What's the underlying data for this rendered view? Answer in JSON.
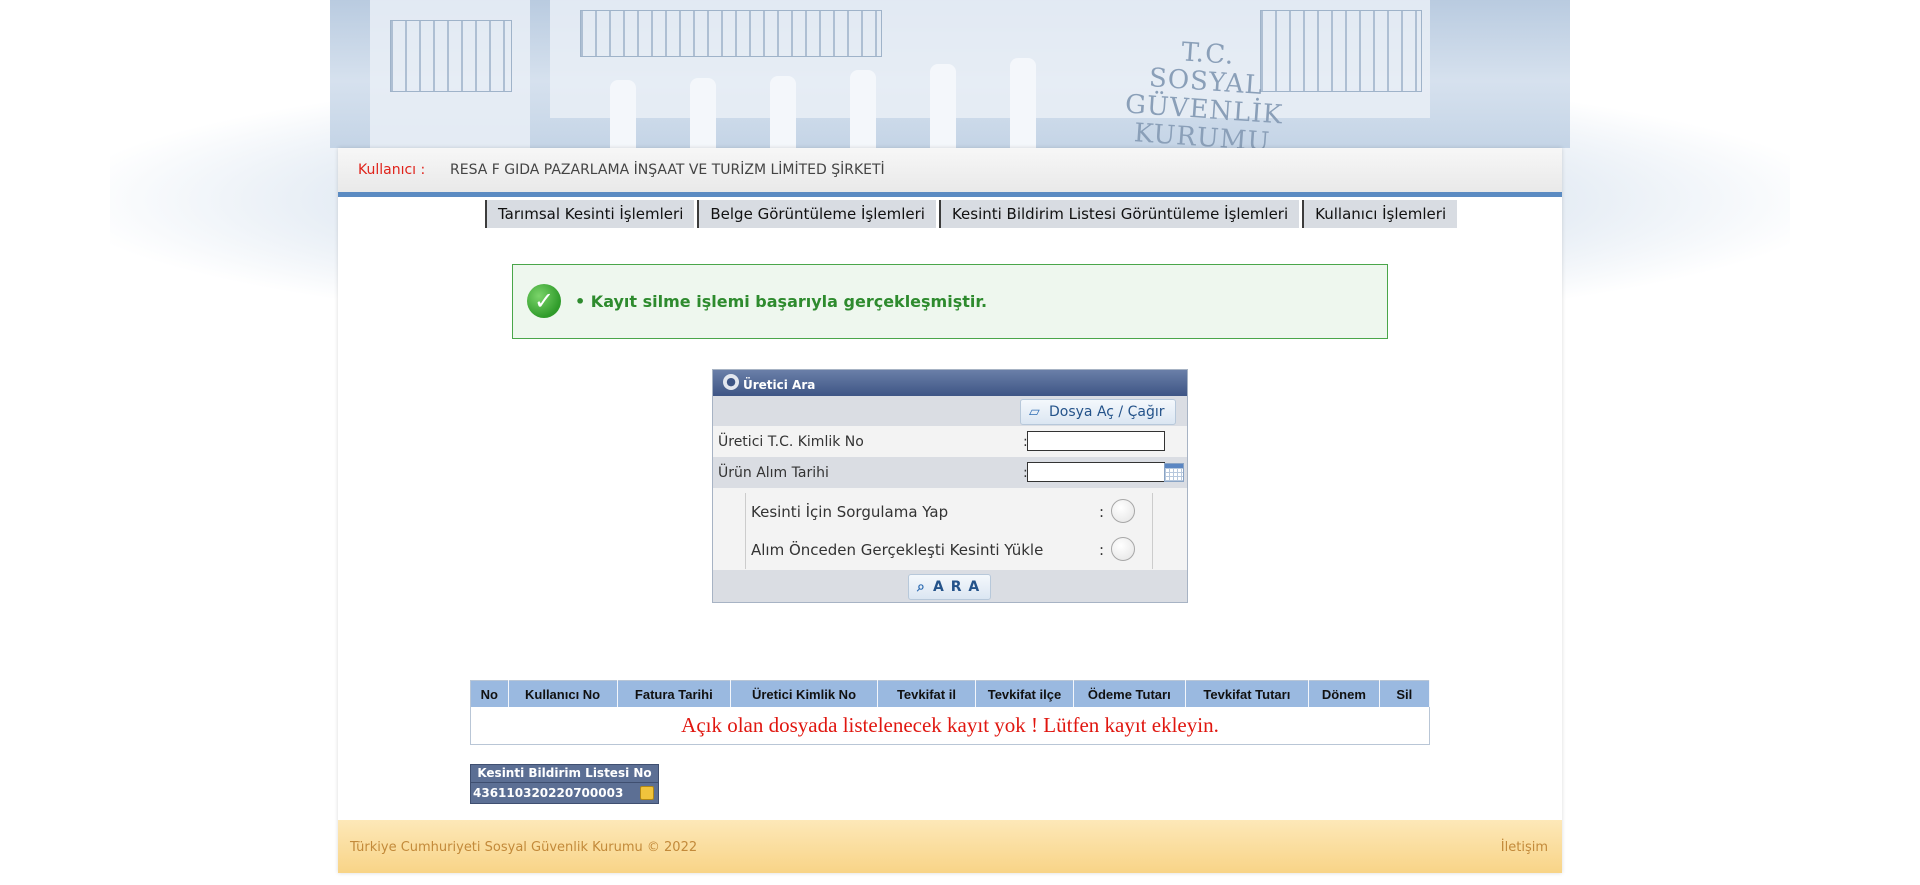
{
  "header": {
    "sign_lines": [
      "T.C.",
      "SOSYAL",
      "GÜVENLİK",
      "KURUMU"
    ]
  },
  "userbar": {
    "label": "Kullanıcı :",
    "value": "RESA F GIDA PAZARLAMA İNŞAAT VE TURİZM LİMİTED ŞİRKETİ"
  },
  "menu": {
    "items": [
      "Tarımsal Kesinti İşlemleri",
      "Belge Görüntüleme İşlemleri",
      "Kesinti Bildirim Listesi Görüntüleme İşlemleri",
      "Kullanıcı İşlemleri"
    ]
  },
  "success": {
    "message": "•  Kayıt silme işlemi başarıyla gerçekleşmiştir."
  },
  "search": {
    "title": "Üretici Ara",
    "file_button": "Dosya Aç / Çağır",
    "tc_label": "Üretici T.C. Kimlik No",
    "tc_value": "",
    "date_label": "Ürün Alım Tarihi",
    "date_value": "",
    "option1": "Kesinti İçin Sorgulama Yap",
    "option2": "Alım Önceden Gerçekleşti Kesinti Yükle",
    "colon": ":",
    "search_button": "A R A"
  },
  "table": {
    "columns": [
      "No",
      "Kullanıcı No",
      "Fatura Tarihi",
      "Üretici Kimlik No",
      "Tevkifat il",
      "Tevkifat ilçe",
      "Ödeme Tutarı",
      "Tevkifat Tutarı",
      "Dönem",
      "Sil"
    ],
    "empty_message": "Açık olan dosyada listelenecek kayıt yok ! Lütfen kayıt ekleyin."
  },
  "list_no": {
    "header": "Kesinti Bildirim Listesi No",
    "value": "436110320220700003"
  },
  "footer": {
    "copyright": "Türkiye Cumhuriyeti Sosyal Güvenlik Kurumu © 2022",
    "contact": "İletişim"
  },
  "colors": {
    "menu_border": "#3c3c3c",
    "success_text": "#2e8b2e",
    "error_text": "#e0160f",
    "header_accent": "#5b8bc2",
    "footer_text": "#c38a3a"
  }
}
